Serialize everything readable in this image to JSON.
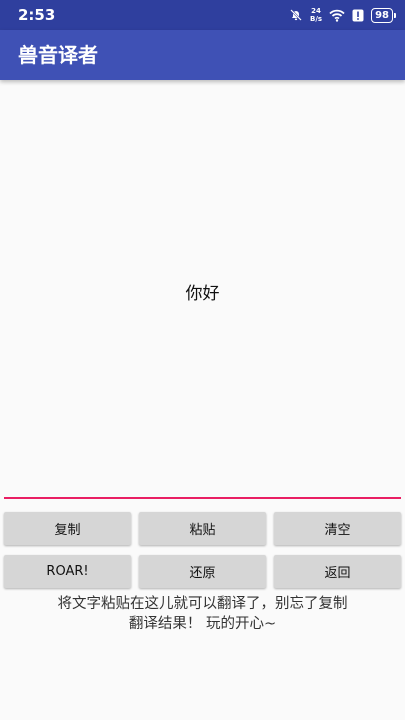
{
  "status_bar": {
    "time": "2:53",
    "net_speed_value": "24",
    "net_speed_unit": "B/s",
    "battery": "98",
    "icons": [
      "mute-bell-icon",
      "wifi-icon",
      "alert-icon",
      "battery-icon"
    ]
  },
  "app_bar": {
    "title": "兽音译者",
    "color": "#3f51b5"
  },
  "editor": {
    "text": "你好",
    "underline_color": "#e91e63"
  },
  "buttons": {
    "copy": "复制",
    "paste": "粘贴",
    "clear": "清空",
    "roar": "ROAR!",
    "restore": "还原",
    "back": "返回"
  },
  "hint": {
    "line1": "将文字粘贴在这儿就可以翻译了，别忘了复制",
    "line2": "翻译结果！ 玩的开心~"
  }
}
